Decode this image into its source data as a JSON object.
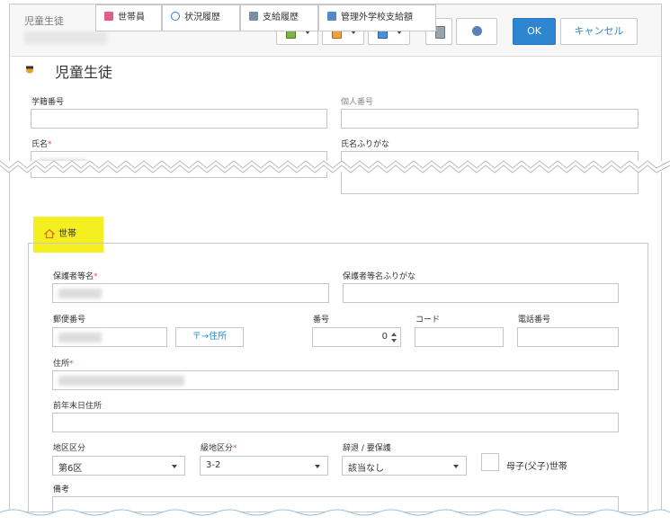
{
  "window": {
    "title": "児童生徒"
  },
  "toolbar": {
    "ok_label": "OK",
    "cancel_label": "キャンセル",
    "icons": [
      "clipboard-green-icon",
      "clipboard-orange-icon",
      "clipboard-blue-icon",
      "calculator-icon",
      "help-icon"
    ]
  },
  "page_title": "児童生徒",
  "fields": {
    "gakuseki": {
      "label": "学籍番号",
      "value": ""
    },
    "kojin": {
      "label": "個人番号",
      "value": ""
    },
    "shimei": {
      "label": "氏名",
      "required": "*"
    },
    "furigana": {
      "label": "氏名ふりがな",
      "value": ""
    }
  },
  "tabs": [
    {
      "label": "世帯",
      "icon": "home-icon"
    },
    {
      "label": "世帯員",
      "icon": "people-icon"
    },
    {
      "label": "状況履歴",
      "icon": "clock-icon"
    },
    {
      "label": "支給履歴",
      "icon": "document-icon"
    },
    {
      "label": "管理外学校支給額",
      "icon": "school-icon"
    }
  ],
  "household": {
    "guardian_label": "保護者等名",
    "guardian_req": "*",
    "guardian_kana_label": "保護者等名ふりがな",
    "postal_label": "郵便番号",
    "address_button": "〒→住所",
    "number_label": "番号",
    "number_value": "0",
    "code_label": "コード",
    "phone_label": "電話番号",
    "address_label": "住所",
    "address_req": "*",
    "prev_address_label": "前年末日住所",
    "district_label": "地区区分",
    "district_value": "第6区",
    "grade_label": "級地区分",
    "grade_req": "*",
    "grade_value": "3-2",
    "decline_label": "辞退 / 要保護",
    "decline_value": "該当なし",
    "single_parent_label": "母子(父子)世帯",
    "remarks_label": "備考"
  },
  "colors": {
    "accent": "#2f86d0",
    "highlight": "#f4ef20",
    "required": "#d9534f"
  }
}
